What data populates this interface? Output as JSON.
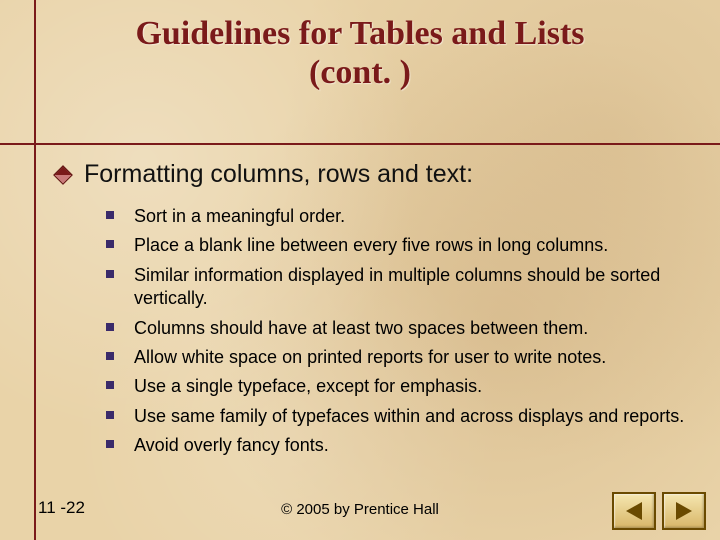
{
  "title_line1": "Guidelines for Tables and Lists",
  "title_line2": "(cont. )",
  "lead": "Formatting columns, rows and text:",
  "bullets": [
    "Sort in a meaningful order.",
    "Place a blank line between every five rows in long columns.",
    "Similar information displayed in multiple columns should be sorted vertically.",
    "Columns should have at least two spaces between them.",
    "Allow white space on printed reports for user to write notes.",
    "Use a single typeface, except for emphasis.",
    "Use same family of typefaces within and across displays and reports.",
    "Avoid overly fancy fonts."
  ],
  "slide_number": "11 -22",
  "copyright": "© 2005 by Prentice Hall"
}
